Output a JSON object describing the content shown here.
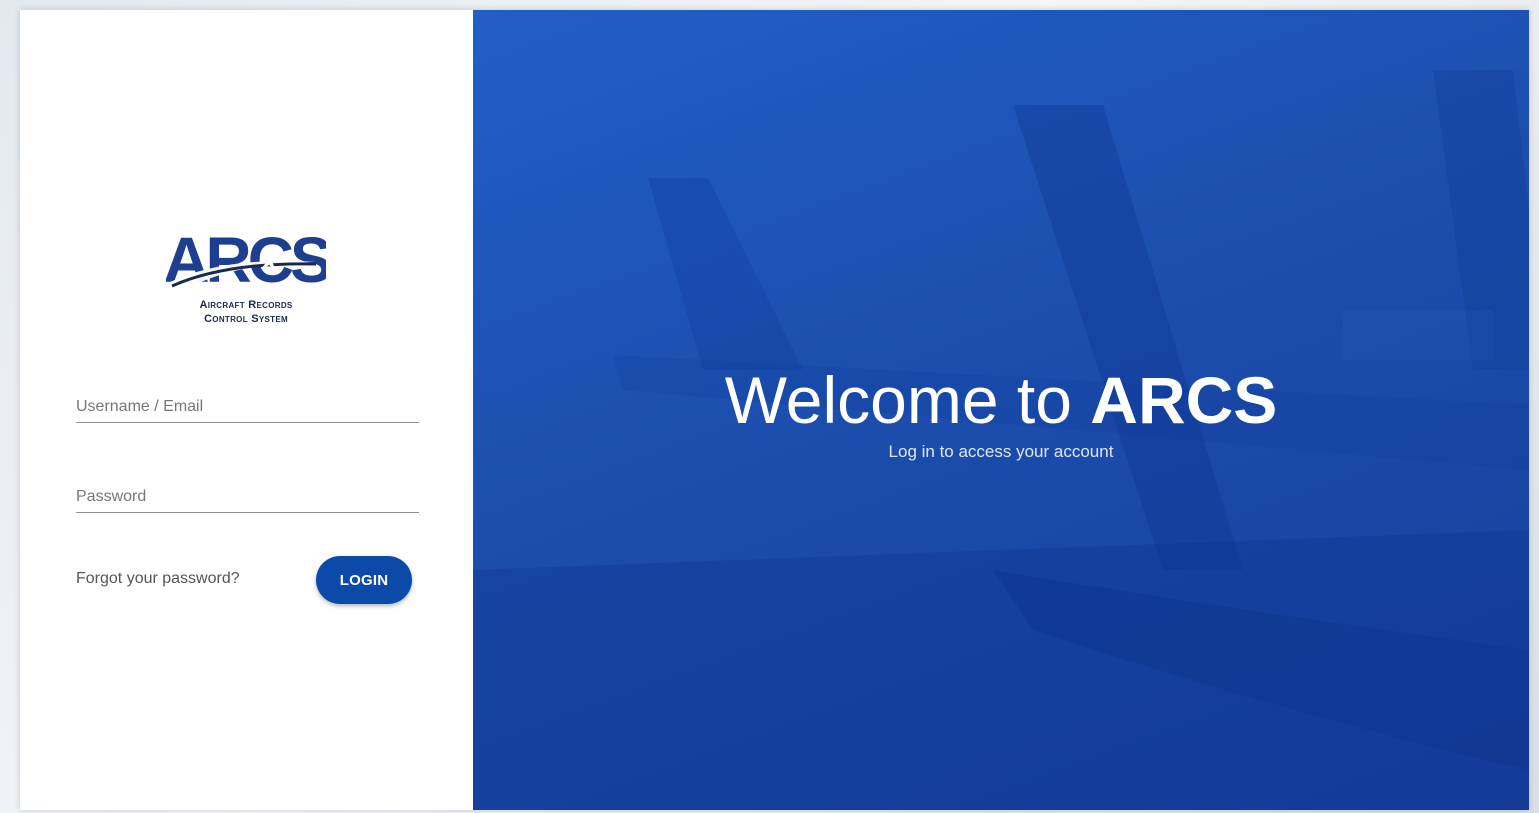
{
  "logo": {
    "wordmark": "ARCS",
    "subtitle_line1": "Aircraft Records",
    "subtitle_line2": "Control System",
    "icon": "airplane-icon"
  },
  "login": {
    "username_placeholder": "Username / Email",
    "password_placeholder": "Password",
    "forgot_link": "Forgot your password?",
    "login_button": "LOGIN"
  },
  "hero": {
    "welcome_prefix": "Welcome to",
    "welcome_brand": "ARCS",
    "subtitle": "Log in to access your account"
  },
  "colors": {
    "primary": "#0b4aa8",
    "hero_blue": "#1549ab",
    "logo_navy": "#1b2a4a"
  }
}
